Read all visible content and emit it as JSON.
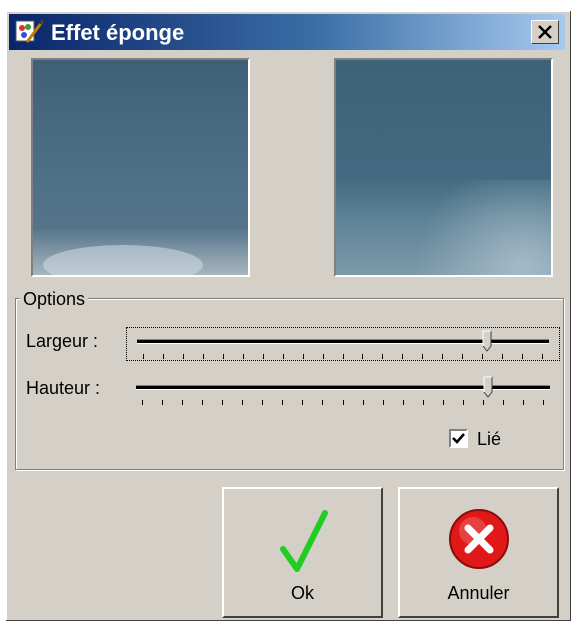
{
  "window": {
    "title": "Effet éponge",
    "close_icon": "close-icon",
    "app_icon": "paint-brush-icon"
  },
  "previews": {
    "left": "original-image-preview",
    "right": "effect-image-preview"
  },
  "options": {
    "group_label": "Options",
    "width_label": "Largeur :",
    "height_label": "Hauteur :",
    "width_value": 0.85,
    "height_value": 0.85,
    "tick_count": 21,
    "linked_label": "Lié",
    "linked_checked": true
  },
  "buttons": {
    "ok_label": "Ok",
    "cancel_label": "Annuler",
    "ok_icon": "checkmark-icon",
    "cancel_icon": "red-x-icon"
  },
  "colors": {
    "face": "#d4d0c8",
    "titlebar_start": "#0a246a",
    "titlebar_end": "#a6caf0",
    "ok_check": "#22cc22",
    "cancel_red": "#e01818"
  }
}
